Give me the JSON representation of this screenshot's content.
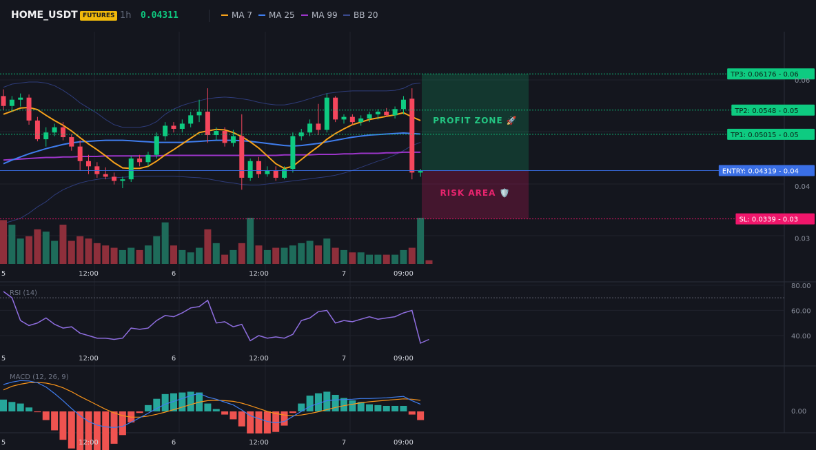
{
  "header": {
    "symbol": "HOME_USDT",
    "badge": "FUTURES",
    "interval": "1h",
    "price": "0.04311",
    "legend": [
      {
        "label": "MA 7",
        "color": "#f7a21b"
      },
      {
        "label": "MA 25",
        "color": "#3f7dee"
      },
      {
        "label": "MA 99",
        "color": "#9c35c9"
      },
      {
        "label": "BB 20",
        "color": "#3a4a8e"
      }
    ]
  },
  "colors": {
    "up": "#0ecb81",
    "down": "#f6465d",
    "vol_up": "#1e6b5a",
    "vol_down": "#8e2f3b",
    "tp": "#0ecb81",
    "entry": "#3a6fe6",
    "sl": "#f0166b",
    "rsi": "#8f6ee0",
    "macd": "#3f7dee",
    "signal": "#f7931a",
    "hist_up": "#26a69a",
    "hist_down": "#ef5350"
  },
  "levels": {
    "tp3": {
      "price": 0.06176,
      "label": "TP3: 0.06176",
      "axis": "0.06"
    },
    "tp2": {
      "price": 0.0548,
      "label": "TP2: 0.0548",
      "axis": "0.05"
    },
    "tp1": {
      "price": 0.05015,
      "label": "TP1: 0.05015",
      "axis": "0.05"
    },
    "entry": {
      "price": 0.04319,
      "label": "ENTRY: 0.04319",
      "axis": "0.04"
    },
    "sl": {
      "price": 0.0339,
      "label": "SL: 0.0339",
      "axis": "0.03"
    }
  },
  "zones": {
    "profit": "PROFIT ZONE 🚀",
    "risk": "RISK AREA 🛡️"
  },
  "axes": {
    "price_ticks": [
      {
        "label": "0.06",
        "value": 0.0606
      },
      {
        "label": "0.04",
        "value": 0.0402
      },
      {
        "label": "0.03",
        "value": 0.0302
      }
    ],
    "time_labels": [
      "5",
      "12:00",
      "6",
      "12:00",
      "7",
      "09:00"
    ],
    "time_index": [
      0,
      10,
      20,
      30,
      40,
      47
    ],
    "rsi_ticks": [
      "80.00",
      "60.00",
      "40.00"
    ],
    "rsi_levels": [
      80,
      60,
      40
    ],
    "rsi_upper": 70,
    "macd_ticks": [
      "0.00"
    ]
  },
  "panels": {
    "rsi_title": "RSI (14)",
    "macd_title": "MACD (12, 26, 9)"
  },
  "chart_data": {
    "type": "candlestick",
    "timeframe": "1h",
    "candles": [
      {
        "o": 0.0575,
        "h": 0.0588,
        "l": 0.0548,
        "c": 0.0556
      },
      {
        "o": 0.0556,
        "h": 0.0575,
        "l": 0.0545,
        "c": 0.0568
      },
      {
        "o": 0.0568,
        "h": 0.058,
        "l": 0.0555,
        "c": 0.0572
      },
      {
        "o": 0.0572,
        "h": 0.0578,
        "l": 0.052,
        "c": 0.0528
      },
      {
        "o": 0.0528,
        "h": 0.0535,
        "l": 0.0488,
        "c": 0.0492
      },
      {
        "o": 0.0492,
        "h": 0.0515,
        "l": 0.0478,
        "c": 0.0505
      },
      {
        "o": 0.0505,
        "h": 0.0522,
        "l": 0.0498,
        "c": 0.0515
      },
      {
        "o": 0.0515,
        "h": 0.0525,
        "l": 0.049,
        "c": 0.0496
      },
      {
        "o": 0.0496,
        "h": 0.0502,
        "l": 0.047,
        "c": 0.0478
      },
      {
        "o": 0.0478,
        "h": 0.049,
        "l": 0.0432,
        "c": 0.045
      },
      {
        "o": 0.045,
        "h": 0.0462,
        "l": 0.0425,
        "c": 0.044
      },
      {
        "o": 0.044,
        "h": 0.0448,
        "l": 0.0418,
        "c": 0.0425
      },
      {
        "o": 0.0425,
        "h": 0.0438,
        "l": 0.0415,
        "c": 0.042
      },
      {
        "o": 0.042,
        "h": 0.0428,
        "l": 0.0405,
        "c": 0.0412
      },
      {
        "o": 0.0412,
        "h": 0.042,
        "l": 0.0398,
        "c": 0.0415
      },
      {
        "o": 0.0415,
        "h": 0.046,
        "l": 0.041,
        "c": 0.0455
      },
      {
        "o": 0.0455,
        "h": 0.0462,
        "l": 0.044,
        "c": 0.0448
      },
      {
        "o": 0.0448,
        "h": 0.0468,
        "l": 0.044,
        "c": 0.0462
      },
      {
        "o": 0.0462,
        "h": 0.0505,
        "l": 0.0455,
        "c": 0.0498
      },
      {
        "o": 0.0498,
        "h": 0.0525,
        "l": 0.049,
        "c": 0.0518
      },
      {
        "o": 0.0518,
        "h": 0.0525,
        "l": 0.0505,
        "c": 0.0512
      },
      {
        "o": 0.0512,
        "h": 0.053,
        "l": 0.0505,
        "c": 0.0522
      },
      {
        "o": 0.0522,
        "h": 0.0545,
        "l": 0.0515,
        "c": 0.0538
      },
      {
        "o": 0.0538,
        "h": 0.0568,
        "l": 0.0525,
        "c": 0.0545
      },
      {
        "o": 0.0545,
        "h": 0.059,
        "l": 0.0485,
        "c": 0.05
      },
      {
        "o": 0.05,
        "h": 0.0515,
        "l": 0.049,
        "c": 0.0508
      },
      {
        "o": 0.0508,
        "h": 0.0515,
        "l": 0.0478,
        "c": 0.0485
      },
      {
        "o": 0.0485,
        "h": 0.051,
        "l": 0.0478,
        "c": 0.0498
      },
      {
        "o": 0.0498,
        "h": 0.054,
        "l": 0.0395,
        "c": 0.0418
      },
      {
        "o": 0.0418,
        "h": 0.0455,
        "l": 0.0412,
        "c": 0.045
      },
      {
        "o": 0.045,
        "h": 0.0458,
        "l": 0.0418,
        "c": 0.0425
      },
      {
        "o": 0.0425,
        "h": 0.044,
        "l": 0.042,
        "c": 0.0432
      },
      {
        "o": 0.0432,
        "h": 0.044,
        "l": 0.0412,
        "c": 0.0418
      },
      {
        "o": 0.0418,
        "h": 0.044,
        "l": 0.0415,
        "c": 0.0435
      },
      {
        "o": 0.0435,
        "h": 0.0505,
        "l": 0.0428,
        "c": 0.0498
      },
      {
        "o": 0.0498,
        "h": 0.0512,
        "l": 0.049,
        "c": 0.0505
      },
      {
        "o": 0.0505,
        "h": 0.053,
        "l": 0.0498,
        "c": 0.0522
      },
      {
        "o": 0.0522,
        "h": 0.056,
        "l": 0.05,
        "c": 0.051
      },
      {
        "o": 0.051,
        "h": 0.058,
        "l": 0.0505,
        "c": 0.0572
      },
      {
        "o": 0.0572,
        "h": 0.0575,
        "l": 0.0525,
        "c": 0.053
      },
      {
        "o": 0.053,
        "h": 0.054,
        "l": 0.0522,
        "c": 0.0535
      },
      {
        "o": 0.0535,
        "h": 0.054,
        "l": 0.052,
        "c": 0.0525
      },
      {
        "o": 0.0525,
        "h": 0.0538,
        "l": 0.0518,
        "c": 0.0532
      },
      {
        "o": 0.0532,
        "h": 0.0545,
        "l": 0.0525,
        "c": 0.054
      },
      {
        "o": 0.054,
        "h": 0.055,
        "l": 0.053,
        "c": 0.0545
      },
      {
        "o": 0.0545,
        "h": 0.0552,
        "l": 0.0535,
        "c": 0.0538
      },
      {
        "o": 0.0538,
        "h": 0.0555,
        "l": 0.0532,
        "c": 0.055
      },
      {
        "o": 0.055,
        "h": 0.0575,
        "l": 0.054,
        "c": 0.0568
      },
      {
        "o": 0.057,
        "h": 0.059,
        "l": 0.0415,
        "c": 0.0428
      },
      {
        "o": 0.0428,
        "h": 0.0435,
        "l": 0.042,
        "c": 0.0431
      }
    ],
    "volume_ratio": [
      0.95,
      0.85,
      0.55,
      0.6,
      0.75,
      0.7,
      0.5,
      0.85,
      0.5,
      0.6,
      0.55,
      0.45,
      0.4,
      0.35,
      0.3,
      0.35,
      0.3,
      0.4,
      0.6,
      0.9,
      0.4,
      0.3,
      0.25,
      0.35,
      0.75,
      0.45,
      0.2,
      0.3,
      0.45,
      1.0,
      0.4,
      0.3,
      0.35,
      0.35,
      0.4,
      0.45,
      0.5,
      0.4,
      0.55,
      0.35,
      0.3,
      0.25,
      0.25,
      0.2,
      0.2,
      0.2,
      0.2,
      0.3,
      0.35,
      1.0,
      0.08
    ],
    "ma7": [
      0.054,
      0.0546,
      0.0552,
      0.0553,
      0.0549,
      0.0538,
      0.0528,
      0.0519,
      0.0508,
      0.0495,
      0.0483,
      0.0472,
      0.046,
      0.0447,
      0.0437,
      0.0436,
      0.0436,
      0.044,
      0.045,
      0.0462,
      0.0472,
      0.0483,
      0.0494,
      0.0505,
      0.0508,
      0.0511,
      0.051,
      0.0505,
      0.0497,
      0.0487,
      0.0475,
      0.046,
      0.0445,
      0.0436,
      0.044,
      0.0453,
      0.0466,
      0.0478,
      0.0492,
      0.0503,
      0.0512,
      0.052,
      0.0525,
      0.053,
      0.0533,
      0.0536,
      0.0539,
      0.0543,
      0.0535,
      0.0528
    ],
    "ma25": [
      0.0445,
      0.0452,
      0.0458,
      0.0464,
      0.0469,
      0.0474,
      0.0478,
      0.0482,
      0.0485,
      0.0487,
      0.0488,
      0.0489,
      0.049,
      0.049,
      0.049,
      0.0489,
      0.0488,
      0.0487,
      0.0486,
      0.0486,
      0.0486,
      0.0486,
      0.0487,
      0.0488,
      0.0489,
      0.049,
      0.049,
      0.049,
      0.0489,
      0.0488,
      0.0486,
      0.0484,
      0.0482,
      0.048,
      0.0479,
      0.048,
      0.0482,
      0.0484,
      0.0487,
      0.049,
      0.0493,
      0.0496,
      0.0498,
      0.05,
      0.0501,
      0.0502,
      0.0503,
      0.0504,
      0.0503,
      0.0502
    ],
    "ma99": [
      0.0452,
      0.0453,
      0.0454,
      0.0455,
      0.0456,
      0.0457,
      0.0457,
      0.0458,
      0.0458,
      0.0459,
      0.0459,
      0.0459,
      0.046,
      0.046,
      0.046,
      0.046,
      0.046,
      0.046,
      0.046,
      0.0461,
      0.0461,
      0.0461,
      0.0461,
      0.0461,
      0.0461,
      0.0461,
      0.0461,
      0.0461,
      0.0461,
      0.0461,
      0.0461,
      0.0461,
      0.0461,
      0.0462,
      0.0462,
      0.0462,
      0.0462,
      0.0463,
      0.0463,
      0.0463,
      0.0464,
      0.0464,
      0.0465,
      0.0465,
      0.0465,
      0.0466,
      0.0466,
      0.0467,
      0.0467,
      0.0467
    ],
    "bb_upper": [
      0.0592,
      0.0598,
      0.06,
      0.0602,
      0.0602,
      0.06,
      0.0595,
      0.0586,
      0.0575,
      0.0562,
      0.0552,
      0.0542,
      0.053,
      0.052,
      0.0515,
      0.0515,
      0.0515,
      0.0518,
      0.0526,
      0.054,
      0.055,
      0.0557,
      0.0562,
      0.0566,
      0.057,
      0.0572,
      0.0573,
      0.0572,
      0.057,
      0.0567,
      0.0563,
      0.056,
      0.0558,
      0.0558,
      0.0561,
      0.0565,
      0.057,
      0.0575,
      0.058,
      0.0582,
      0.0584,
      0.0585,
      0.0585,
      0.0585,
      0.0585,
      0.0585,
      0.0586,
      0.059,
      0.0598,
      0.06
    ],
    "bb_lower": [
      0.033,
      0.0335,
      0.034,
      0.035,
      0.0362,
      0.0372,
      0.0385,
      0.0395,
      0.0402,
      0.0408,
      0.0412,
      0.0415,
      0.0417,
      0.0418,
      0.0419,
      0.042,
      0.0421,
      0.0421,
      0.0421,
      0.0421,
      0.0421,
      0.042,
      0.0419,
      0.0418,
      0.0416,
      0.0413,
      0.041,
      0.0408,
      0.0405,
      0.0404,
      0.0404,
      0.0406,
      0.0408,
      0.041,
      0.0412,
      0.0414,
      0.0416,
      0.0418,
      0.042,
      0.0423,
      0.0427,
      0.0432,
      0.0438,
      0.0444,
      0.045,
      0.0455,
      0.0462,
      0.047,
      0.048,
      0.0486
    ],
    "rsi": [
      75,
      70,
      52,
      48,
      50,
      54,
      49,
      46,
      47,
      42,
      40,
      38,
      38,
      37,
      38,
      46,
      45,
      46,
      52,
      56,
      55,
      58,
      62,
      63,
      68,
      50,
      51,
      47,
      49,
      36,
      40,
      38,
      39,
      38,
      41,
      52,
      54,
      59,
      60,
      50,
      52,
      51,
      53,
      55,
      53,
      54,
      55,
      58,
      60,
      34,
      37
    ],
    "macd": [
      0.00075,
      0.00082,
      0.00086,
      0.00085,
      0.0008,
      0.00068,
      0.0005,
      0.0003,
      8e-05,
      -0.00012,
      -0.00028,
      -0.00038,
      -0.00043,
      -0.00045,
      -0.00042,
      -0.0003,
      -0.00018,
      -5e-05,
      8e-05,
      0.0002,
      0.00028,
      0.00036,
      0.00044,
      0.0005,
      0.0004,
      0.00034,
      0.00026,
      0.00018,
      4e-05,
      -0.00012,
      -0.0002,
      -0.00028,
      -0.00032,
      -0.00028,
      -0.00014,
      0.0,
      0.00014,
      0.00022,
      0.0003,
      0.00032,
      0.00033,
      0.00034,
      0.00036,
      0.00036,
      0.00037,
      0.00038,
      0.0004,
      0.00042,
      0.0003,
      0.0002
    ],
    "signal": [
      0.0006,
      0.0007,
      0.00076,
      0.0008,
      0.00081,
      0.00079,
      0.00074,
      0.00066,
      0.00055,
      0.00042,
      0.0003,
      0.00018,
      6e-05,
      -4e-05,
      -0.00012,
      -0.00016,
      -0.00016,
      -0.00013,
      -8e-05,
      -2e-05,
      5e-05,
      0.00012,
      0.00019,
      0.00026,
      0.0003,
      0.00031,
      0.0003,
      0.00028,
      0.00023,
      0.00016,
      8e-05,
      0.0,
      -6e-05,
      -0.0001,
      -0.00012,
      -0.0001,
      -6e-05,
      -1e-05,
      5e-05,
      0.00011,
      0.00016,
      0.0002,
      0.00024,
      0.00027,
      0.00029,
      0.00031,
      0.00033,
      0.00035,
      0.00034,
      0.00031
    ]
  }
}
